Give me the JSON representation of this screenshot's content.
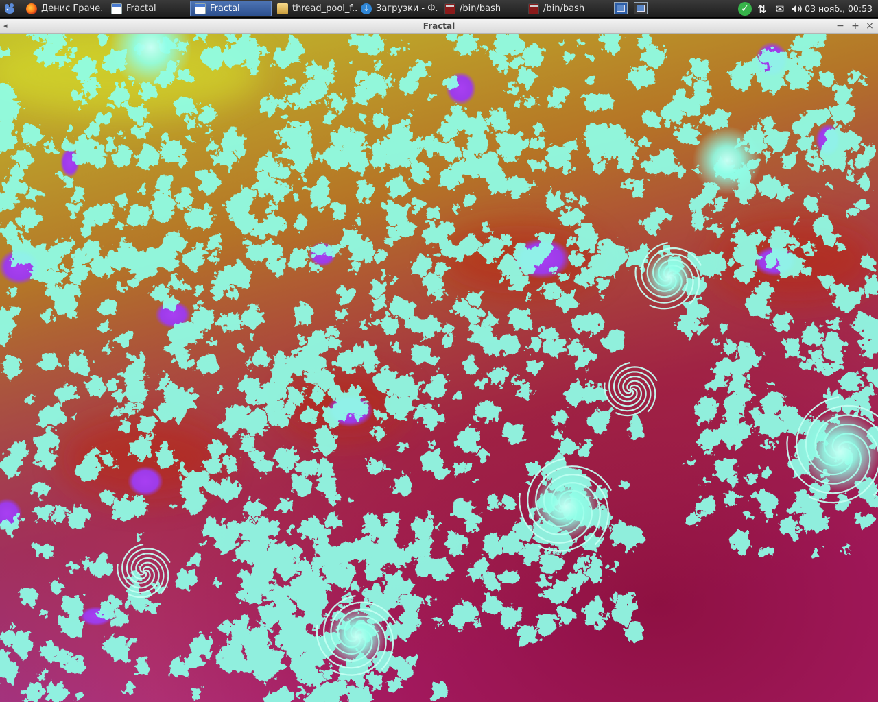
{
  "taskbar": {
    "tasks": [
      {
        "label": "Денис Граче...",
        "icon": "firefox-icon",
        "active": false
      },
      {
        "label": "Fractal",
        "icon": "window-icon",
        "active": false
      },
      {
        "label": "Fractal",
        "icon": "window-icon",
        "active": true
      },
      {
        "label": "thread_pool_f...",
        "icon": "archive-icon",
        "active": false
      },
      {
        "label": "Загрузки - Ф...",
        "icon": "download-icon",
        "active": false
      },
      {
        "label": "/bin/bash",
        "icon": "terminal-icon",
        "active": false
      },
      {
        "label": "/bin/bash",
        "icon": "terminal-icon",
        "active": false
      }
    ],
    "clock": "03 нояб., 00:53"
  },
  "window": {
    "title": "Fractal",
    "menu_glyph": "◂",
    "minimize_glyph": "−",
    "maximize_glyph": "+",
    "close_glyph": "×"
  },
  "colors": {
    "filaments": "#8fffe8",
    "magenta": "#a0185a",
    "violet": "#a33ef0",
    "gold": "#b88a10",
    "olive": "#b4b818"
  }
}
